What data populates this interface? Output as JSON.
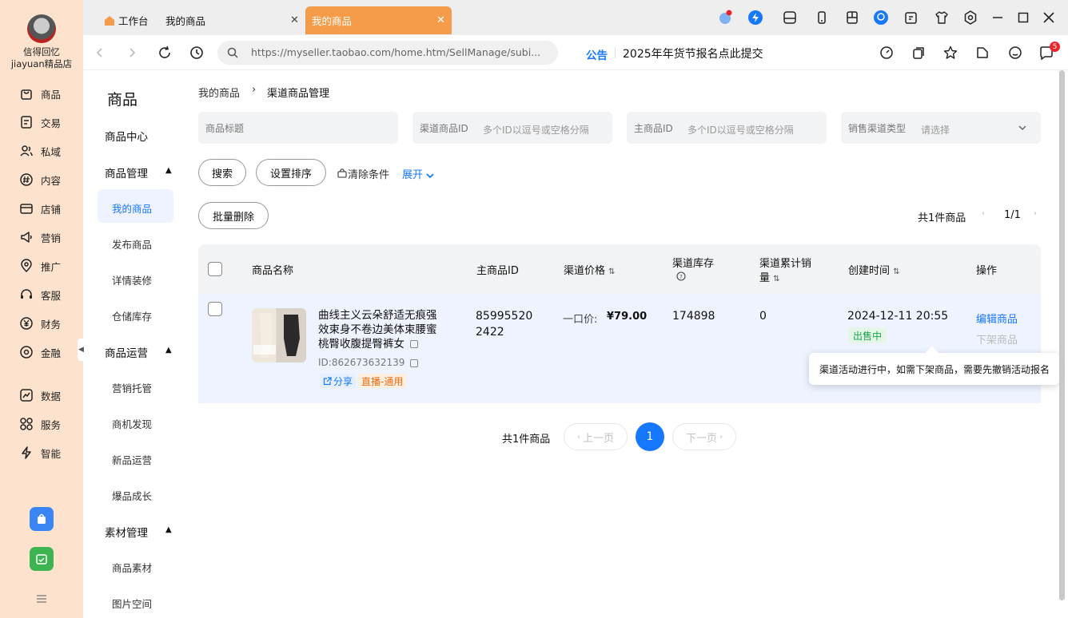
{
  "rail": {
    "store_name_1": "信得回忆",
    "store_name_2": "jiayuan精品店",
    "items": [
      {
        "label": "商品",
        "icon": "bag-icon"
      },
      {
        "label": "交易",
        "icon": "order-icon"
      },
      {
        "label": "私域",
        "icon": "users-icon"
      },
      {
        "label": "内容",
        "icon": "hashtag-icon"
      },
      {
        "label": "店铺",
        "icon": "store-icon"
      },
      {
        "label": "营销",
        "icon": "megaphone-icon"
      },
      {
        "label": "推广",
        "icon": "location-icon"
      },
      {
        "label": "客服",
        "icon": "headset-icon"
      },
      {
        "label": "财务",
        "icon": "yen-icon"
      },
      {
        "label": "金融",
        "icon": "target-icon"
      },
      {
        "label": "数据",
        "icon": "chart-icon"
      },
      {
        "label": "服务",
        "icon": "grid-icon"
      },
      {
        "label": "智能",
        "icon": "lightning-icon"
      }
    ]
  },
  "tabs": {
    "home": "工作台",
    "my_products_1": "我的商品",
    "my_products_2": "我的商品",
    "close": "✕"
  },
  "address": {
    "url": "https://myseller.taobao.com/home.htm/SellManage/subi...",
    "notice_label": "公告",
    "notice_text": "2025年年货节报名点此提交",
    "message_badge": "5"
  },
  "nav": {
    "title": "商品",
    "center": "商品中心",
    "group_manage": "商品管理",
    "manage_items": [
      "我的商品",
      "发布商品",
      "详情装修",
      "仓储库存"
    ],
    "group_operate": "商品运营",
    "operate_items": [
      "营销托管",
      "商机发现",
      "新品运营",
      "爆品成长"
    ],
    "group_material": "素材管理",
    "material_items": [
      "商品素材",
      "图片空间"
    ]
  },
  "breadcrumb": {
    "parent": "我的商品",
    "separator": "›",
    "current": "渠道商品管理"
  },
  "filters": {
    "title_placeholder": "商品标题",
    "channel_id_label": "渠道商品ID",
    "channel_id_placeholder": "多个ID以逗号或空格分隔",
    "main_id_label": "主商品ID",
    "main_id_placeholder": "多个ID以逗号或空格分隔",
    "channel_type_label": "销售渠道类型",
    "channel_type_placeholder": "请选择"
  },
  "actions": {
    "search": "搜索",
    "sort": "设置排序",
    "clear": "清除条件",
    "expand": "展开",
    "batch_delete": "批量删除",
    "total": "共1件商品",
    "page_count": "1/1"
  },
  "table": {
    "headers": {
      "name": "商品名称",
      "main_id": "主商品ID",
      "price": "渠道价格",
      "stock": "渠道库存",
      "sales_1": "渠道累计销",
      "sales_2": "量",
      "created": "创建时间",
      "ops": "操作"
    },
    "rows": [
      {
        "title": "曲线主义云朵舒适无痕强效束身不卷边美体束腰蜜桃臀收腹提臀裤女",
        "id": "ID:862673632139",
        "share": "分享",
        "tag": "直播-通用",
        "main_id_1": "85995520",
        "main_id_2": "2422",
        "price_label": "一口价:",
        "price": "¥79.00",
        "stock": "174898",
        "sales": "0",
        "created": "2024-12-11 20:55",
        "status": "出售中",
        "op_edit": "编辑商品",
        "op_off": "下架商品"
      }
    ]
  },
  "tooltip": "渠道活动进行中，如需下架商品，需要先撤销活动报名",
  "pagination": {
    "total": "共1件商品",
    "prev": "上一页",
    "current": "1",
    "next": "下一页"
  },
  "colors": {
    "accent": "#1677ff",
    "tab_active": "#f49c4a",
    "rail_bg": "#fde3cd"
  }
}
